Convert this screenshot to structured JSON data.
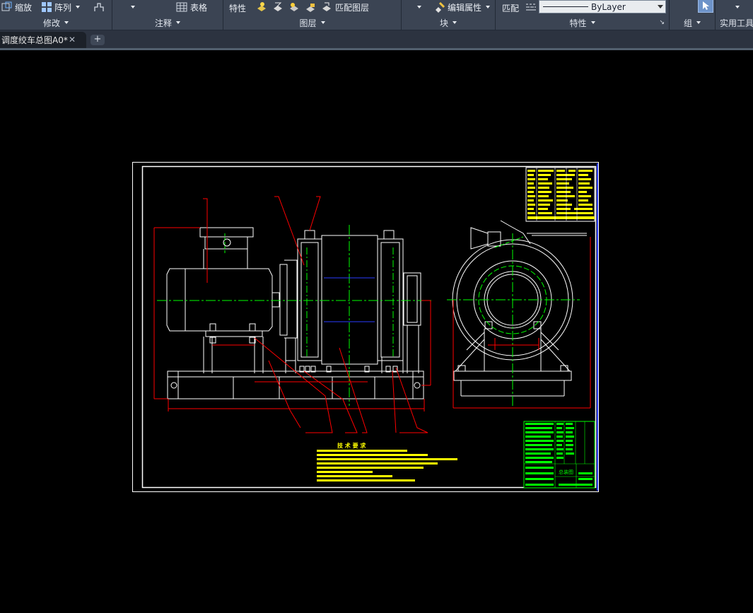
{
  "ribbon": {
    "modify": {
      "zoom_label": "缩放",
      "array_label": "阵列",
      "title": "修改"
    },
    "annotation": {
      "table_label": "表格",
      "title": "注释"
    },
    "layers": {
      "props_label": "特性",
      "match_layer_label": "匹配图层",
      "title": "图层"
    },
    "block": {
      "edit_attr_label": "编辑属性",
      "title": "块"
    },
    "properties": {
      "match_label": "匹配",
      "linetype_value": "ByLayer",
      "title": "特性"
    },
    "group": {
      "title": "组"
    },
    "utilities": {
      "title": "实用工具"
    }
  },
  "tabs": {
    "active_tab_label": "调度绞车总图A0*",
    "close_glyph": "✕",
    "new_tab_glyph": "+"
  },
  "drawing": {
    "tech_req_title": "技 术 要 求",
    "title_block_name": "总装图",
    "colors": {
      "frame": "#ffffff",
      "dimension": "#ff0000",
      "centerline": "#00ff00",
      "hidden": "#0000ff",
      "table_fill": "#ffff00",
      "titleblock": "#00ff00",
      "border": "#0000ff"
    }
  }
}
